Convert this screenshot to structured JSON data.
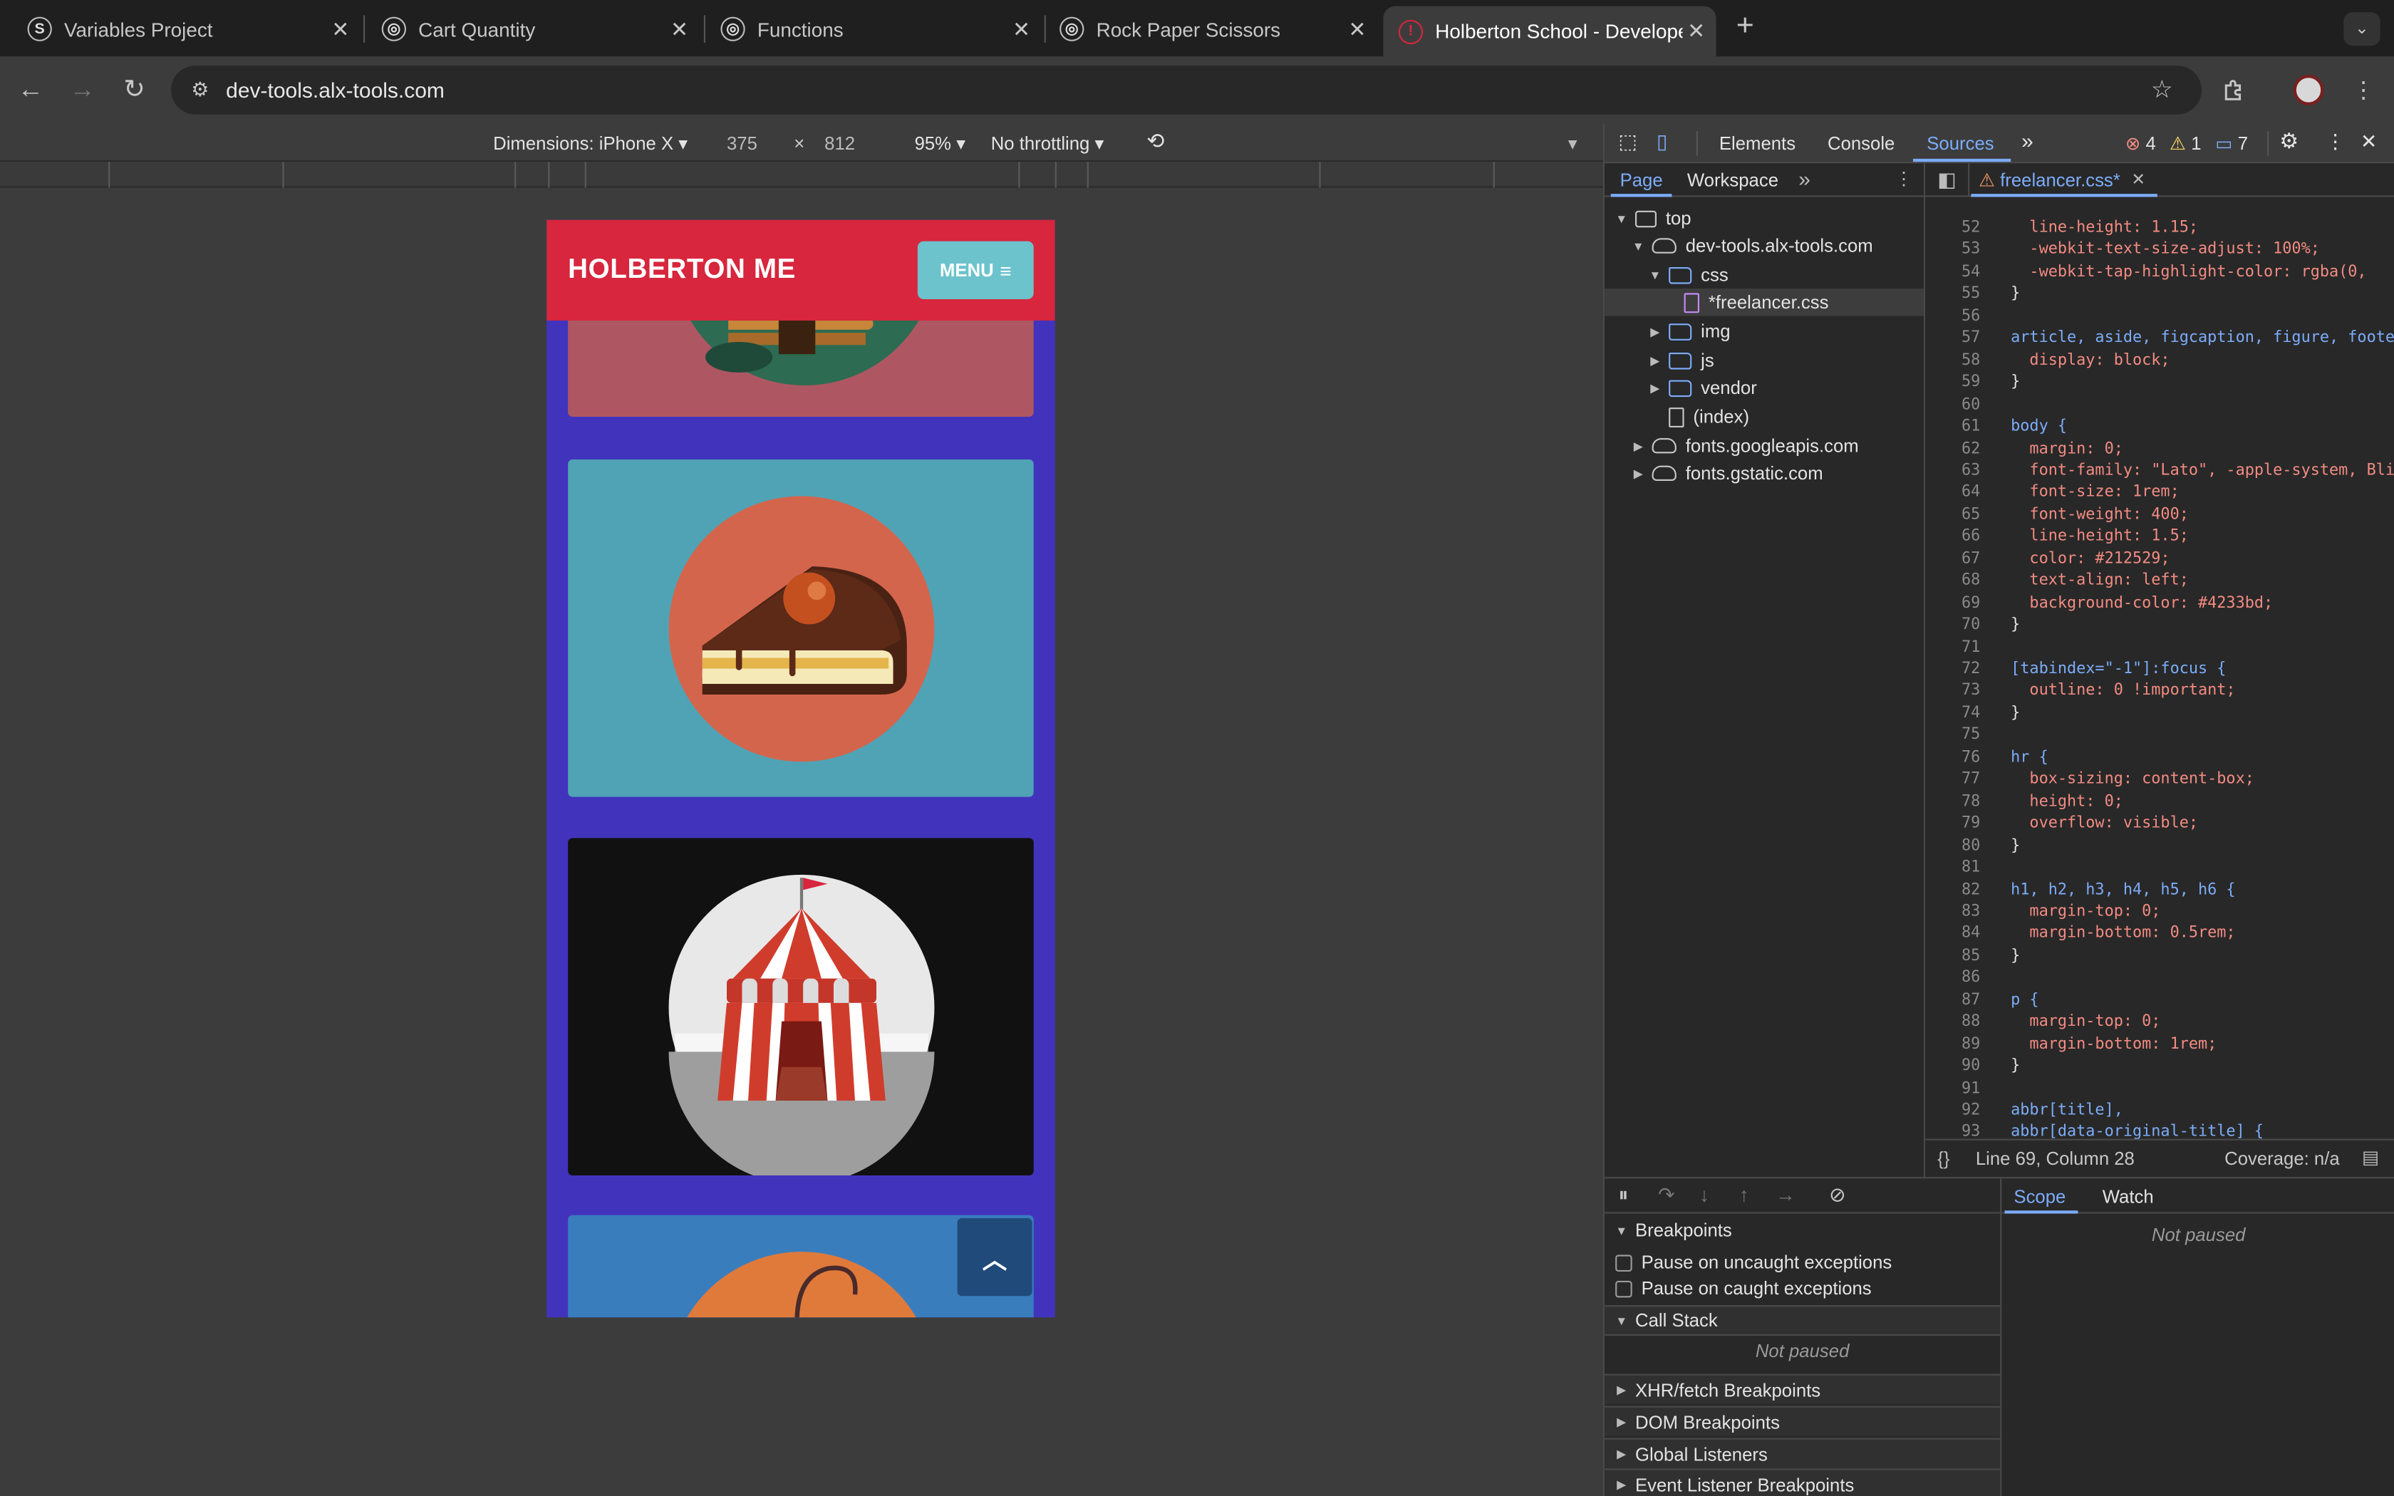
{
  "browser": {
    "tabs": [
      {
        "title": "Variables Project",
        "favicon": "S"
      },
      {
        "title": "Cart Quantity",
        "favicon": "globe"
      },
      {
        "title": "Functions",
        "favicon": "globe"
      },
      {
        "title": "Rock Paper Scissors",
        "favicon": "globe"
      },
      {
        "title": "Holberton School - Developer",
        "favicon": "holberton",
        "active": true
      }
    ],
    "new_tab_label": "+",
    "url": "dev-tools.alx-tools.com"
  },
  "device_toolbar": {
    "dimensions_label": "Dimensions: iPhone X",
    "width": "375",
    "times": "×",
    "height": "812",
    "zoom": "95%",
    "throttling": "No throttling"
  },
  "page": {
    "brand": "HOLBERTON ME",
    "menu_label": "MENU",
    "colors": {
      "background": "#4233bd",
      "navbar": "#d7263d",
      "menu_button": "#6cc3cc"
    }
  },
  "devtools": {
    "tabs": [
      "Elements",
      "Console",
      "Sources"
    ],
    "active_tab": "Sources",
    "errors": "4",
    "warnings": "1",
    "messages": "7",
    "navigator_tabs": [
      "Page",
      "Workspace"
    ],
    "tree": [
      {
        "label": "top",
        "level": 0
      },
      {
        "label": "dev-tools.alx-tools.com",
        "level": 1
      },
      {
        "label": "css",
        "level": 2
      },
      {
        "label": "*freelancer.css",
        "level": 3
      },
      {
        "label": "img",
        "level": 2
      },
      {
        "label": "js",
        "level": 2
      },
      {
        "label": "vendor",
        "level": 2
      },
      {
        "label": "(index)",
        "level": 2
      },
      {
        "label": "fonts.googleapis.com",
        "level": 1
      },
      {
        "label": "fonts.gstatic.com",
        "level": 1
      }
    ],
    "open_file": "freelancer.css*",
    "code_lines": [
      {
        "n": "52",
        "t": "  line-height: 1.15;"
      },
      {
        "n": "53",
        "t": "  -webkit-text-size-adjust: 100%;"
      },
      {
        "n": "54",
        "t": "  -webkit-tap-highlight-color: rgba(0,"
      },
      {
        "n": "55",
        "t": "}"
      },
      {
        "n": "56",
        "t": ""
      },
      {
        "n": "57",
        "t": "article, aside, figcaption, figure, foote"
      },
      {
        "n": "58",
        "t": "  display: block;"
      },
      {
        "n": "59",
        "t": "}"
      },
      {
        "n": "60",
        "t": ""
      },
      {
        "n": "61",
        "t": "body {"
      },
      {
        "n": "62",
        "t": "  margin: 0;"
      },
      {
        "n": "63",
        "t": "  font-family: \"Lato\", -apple-system, Bli"
      },
      {
        "n": "64",
        "t": "  font-size: 1rem;"
      },
      {
        "n": "65",
        "t": "  font-weight: 400;"
      },
      {
        "n": "66",
        "t": "  line-height: 1.5;"
      },
      {
        "n": "67",
        "t": "  color: #212529;"
      },
      {
        "n": "68",
        "t": "  text-align: left;"
      },
      {
        "n": "69",
        "t": "  background-color: #4233bd;"
      },
      {
        "n": "70",
        "t": "}"
      },
      {
        "n": "71",
        "t": ""
      },
      {
        "n": "72",
        "t": "[tabindex=\"-1\"]:focus {"
      },
      {
        "n": "73",
        "t": "  outline: 0 !important;"
      },
      {
        "n": "74",
        "t": "}"
      },
      {
        "n": "75",
        "t": ""
      },
      {
        "n": "76",
        "t": "hr {"
      },
      {
        "n": "77",
        "t": "  box-sizing: content-box;"
      },
      {
        "n": "78",
        "t": "  height: 0;"
      },
      {
        "n": "79",
        "t": "  overflow: visible;"
      },
      {
        "n": "80",
        "t": "}"
      },
      {
        "n": "81",
        "t": ""
      },
      {
        "n": "82",
        "t": "h1, h2, h3, h4, h5, h6 {"
      },
      {
        "n": "83",
        "t": "  margin-top: 0;"
      },
      {
        "n": "84",
        "t": "  margin-bottom: 0.5rem;"
      },
      {
        "n": "85",
        "t": "}"
      },
      {
        "n": "86",
        "t": ""
      },
      {
        "n": "87",
        "t": "p {"
      },
      {
        "n": "88",
        "t": "  margin-top: 0;"
      },
      {
        "n": "89",
        "t": "  margin-bottom: 1rem;"
      },
      {
        "n": "90",
        "t": "}"
      },
      {
        "n": "91",
        "t": ""
      },
      {
        "n": "92",
        "t": "abbr[title],"
      },
      {
        "n": "93",
        "t": "abbr[data-original-title] {"
      }
    ],
    "cursor_position": "Line 69, Column 28",
    "coverage": "Coverage: n/a",
    "debugger": {
      "breakpoints": "Breakpoints",
      "pause_uncaught": "Pause on uncaught exceptions",
      "pause_caught": "Pause on caught exceptions",
      "call_stack": "Call Stack",
      "not_paused": "Not paused",
      "xhr": "XHR/fetch Breakpoints",
      "dom": "DOM Breakpoints",
      "global": "Global Listeners",
      "event": "Event Listener Breakpoints",
      "scope": "Scope",
      "watch": "Watch",
      "scope_not_paused": "Not paused"
    }
  }
}
